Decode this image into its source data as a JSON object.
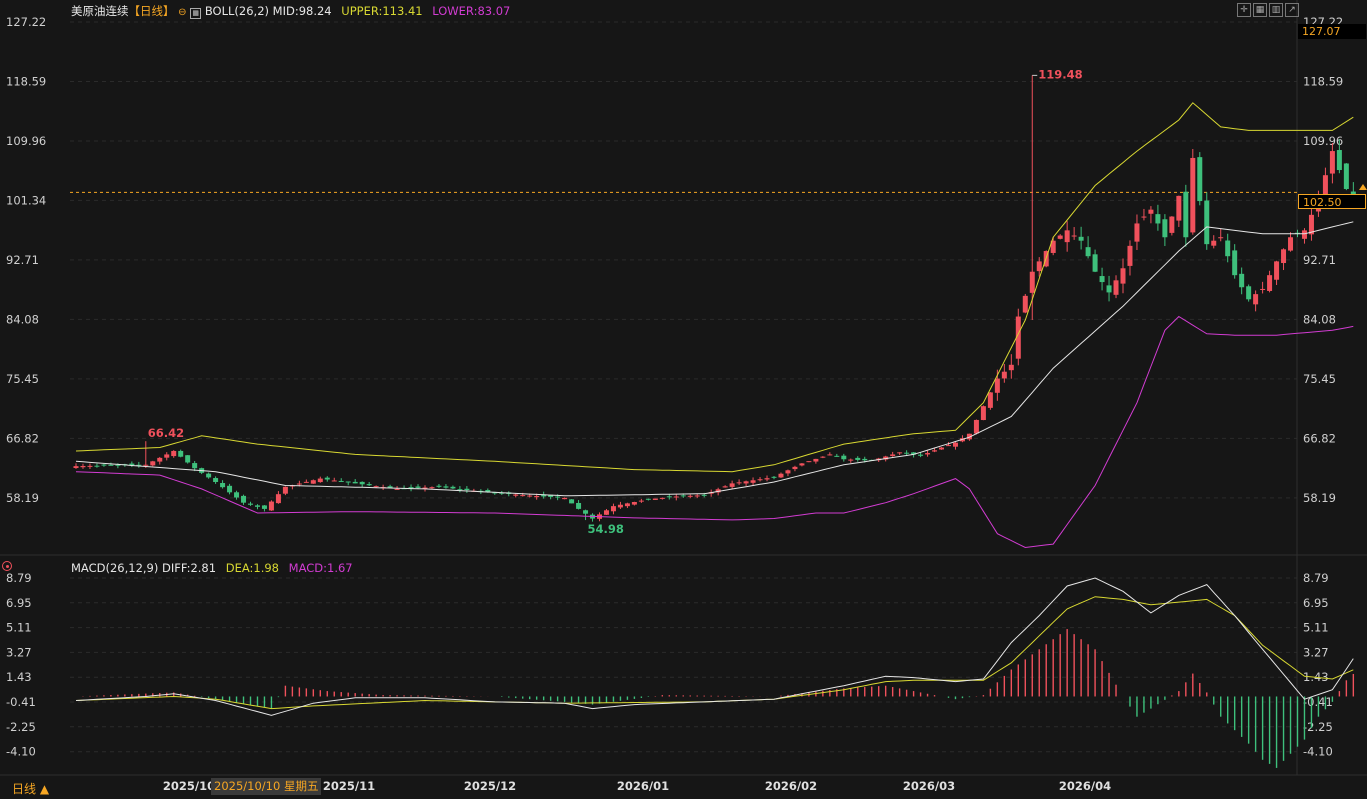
{
  "header": {
    "symbol": "美原油连续",
    "period": "【日线】",
    "boll_label": "BOLL(26,2)",
    "mid": "MID:98.24",
    "upper": "UPPER:113.41",
    "lower": "LOWER:83.07"
  },
  "macd_header": {
    "label": "MACD(26,12,9)",
    "diff": "DIFF:2.81",
    "dea": "DEA:1.98",
    "macd": "MACD:1.67"
  },
  "toolbar": {
    "icons": [
      "crosshair-icon",
      "grid-icon",
      "bars-icon",
      "share-icon"
    ]
  },
  "current_price_tag": "102.50",
  "top_price_tag": "127.07",
  "bottom_bar": {
    "period_label": "日线 ▲",
    "cursor_date": "2025/10/10 星期五"
  },
  "colors": {
    "up": "#f0515c",
    "down": "#3ec07c",
    "mid": "#e6e6e6",
    "upper": "#d8d832",
    "lower": "#d23cd2",
    "dea": "#d8d832",
    "diff": "#e6e6e6",
    "bg": "#161616",
    "price_line": "#f5a623"
  },
  "chart_data": [
    {
      "type": "candlestick",
      "title": "美原油连续",
      "y_ticks": [
        "127.22",
        "118.59",
        "109.96",
        "101.34",
        "92.71",
        "84.08",
        "75.45",
        "66.82",
        "58.19"
      ],
      "ylim": [
        50.5,
        127.22
      ],
      "x_labels": [
        "2025/10",
        "2025/11",
        "2025/12",
        "2026/01",
        "2026/02",
        "2026/03",
        "2026/04"
      ],
      "annotations": [
        {
          "text": "66.42",
          "type": "high"
        },
        {
          "text": "54.98",
          "type": "low"
        },
        {
          "text": "119.48",
          "type": "high"
        }
      ],
      "current_price": 102.5,
      "keypoints": [
        [
          0,
          62.8
        ],
        [
          10,
          63.0
        ],
        [
          14,
          65.0
        ],
        [
          17,
          62.5
        ],
        [
          20,
          60.5
        ],
        [
          24,
          57.5
        ],
        [
          27,
          56.6
        ],
        [
          30,
          59.8
        ],
        [
          35,
          61.0
        ],
        [
          40,
          60.3
        ],
        [
          46,
          59.5
        ],
        [
          52,
          59.8
        ],
        [
          58,
          59.1
        ],
        [
          64,
          58.6
        ],
        [
          70,
          58.2
        ],
        [
          72,
          56.6
        ],
        [
          74,
          55.2
        ],
        [
          77,
          57.0
        ],
        [
          82,
          58.0
        ],
        [
          86,
          58.4
        ],
        [
          90,
          58.6
        ],
        [
          94,
          60.3
        ],
        [
          100,
          61.2
        ],
        [
          104,
          63.2
        ],
        [
          108,
          64.5
        ],
        [
          110,
          63.8
        ],
        [
          114,
          63.6
        ],
        [
          118,
          64.8
        ],
        [
          121,
          64.3
        ],
        [
          124,
          65.5
        ],
        [
          126,
          66.2
        ],
        [
          128,
          67.5
        ],
        [
          130,
          71.5
        ],
        [
          132,
          75.5
        ],
        [
          134,
          77.5
        ],
        [
          135,
          84.5
        ],
        [
          136,
          87.5
        ],
        [
          137,
          91.0
        ],
        [
          140,
          95.5
        ],
        [
          142,
          97.0
        ],
        [
          144,
          95.5
        ],
        [
          146,
          91.0
        ],
        [
          148,
          88.0
        ],
        [
          150,
          91.5
        ],
        [
          152,
          98.0
        ],
        [
          154,
          100.0
        ],
        [
          156,
          96.0
        ],
        [
          158,
          102.0
        ],
        [
          159,
          96.0
        ],
        [
          160,
          107.5
        ],
        [
          162,
          95.0
        ],
        [
          164,
          96.0
        ],
        [
          166,
          90.5
        ],
        [
          168,
          87.0
        ],
        [
          170,
          88.5
        ],
        [
          172,
          92.5
        ],
        [
          174,
          96.0
        ],
        [
          176,
          97.0
        ],
        [
          178,
          101.5
        ],
        [
          180,
          108.5
        ],
        [
          182,
          103.0
        ],
        [
          183,
          102.0
        ]
      ],
      "boll_mid_keypoints": [
        [
          0,
          63.5
        ],
        [
          20,
          62.0
        ],
        [
          30,
          60.0
        ],
        [
          50,
          59.5
        ],
        [
          70,
          58.5
        ],
        [
          90,
          58.8
        ],
        [
          100,
          60.5
        ],
        [
          110,
          63.0
        ],
        [
          120,
          64.5
        ],
        [
          128,
          67.0
        ],
        [
          134,
          70.0
        ],
        [
          140,
          77.0
        ],
        [
          150,
          86.0
        ],
        [
          158,
          94.0
        ],
        [
          162,
          97.5
        ],
        [
          166,
          97.0
        ],
        [
          170,
          96.5
        ],
        [
          176,
          96.5
        ],
        [
          180,
          97.5
        ],
        [
          183,
          98.24
        ]
      ],
      "boll_upper_keypoints": [
        [
          0,
          65.0
        ],
        [
          12,
          65.5
        ],
        [
          18,
          67.2
        ],
        [
          26,
          66.0
        ],
        [
          40,
          64.5
        ],
        [
          60,
          63.5
        ],
        [
          80,
          62.3
        ],
        [
          94,
          62.0
        ],
        [
          100,
          63.0
        ],
        [
          110,
          66.0
        ],
        [
          120,
          67.5
        ],
        [
          126,
          68.0
        ],
        [
          130,
          72.0
        ],
        [
          136,
          84.0
        ],
        [
          140,
          96.0
        ],
        [
          146,
          103.5
        ],
        [
          152,
          108.5
        ],
        [
          158,
          113.0
        ],
        [
          160,
          115.5
        ],
        [
          164,
          112.0
        ],
        [
          168,
          111.5
        ],
        [
          174,
          111.5
        ],
        [
          180,
          111.5
        ],
        [
          183,
          113.41
        ]
      ],
      "boll_lower_keypoints": [
        [
          0,
          62.0
        ],
        [
          12,
          61.5
        ],
        [
          18,
          59.5
        ],
        [
          26,
          56.0
        ],
        [
          40,
          56.2
        ],
        [
          60,
          56.0
        ],
        [
          80,
          55.3
        ],
        [
          94,
          55.0
        ],
        [
          100,
          55.2
        ],
        [
          106,
          56.0
        ],
        [
          110,
          56.0
        ],
        [
          116,
          57.5
        ],
        [
          120,
          58.8
        ],
        [
          126,
          61.0
        ],
        [
          128,
          59.5
        ],
        [
          132,
          53.0
        ],
        [
          136,
          51.0
        ],
        [
          140,
          51.5
        ],
        [
          146,
          60.0
        ],
        [
          152,
          72.0
        ],
        [
          156,
          82.5
        ],
        [
          158,
          84.5
        ],
        [
          162,
          82.0
        ],
        [
          166,
          81.8
        ],
        [
          172,
          81.8
        ],
        [
          180,
          82.5
        ],
        [
          183,
          83.07
        ]
      ]
    },
    {
      "type": "macd",
      "y_ticks": [
        "8.79",
        "6.95",
        "5.11",
        "3.27",
        "1.43",
        "-0.41",
        "-2.25",
        "-4.10"
      ],
      "ylim": [
        -5.6,
        9.2
      ],
      "series_names": [
        "DIFF",
        "DEA",
        "MACD"
      ],
      "diff_keypoints": [
        [
          0,
          -0.3
        ],
        [
          10,
          0.0
        ],
        [
          14,
          0.2
        ],
        [
          20,
          -0.3
        ],
        [
          28,
          -1.4
        ],
        [
          34,
          -0.5
        ],
        [
          40,
          -0.1
        ],
        [
          50,
          -0.1
        ],
        [
          60,
          -0.4
        ],
        [
          70,
          -0.5
        ],
        [
          74,
          -0.9
        ],
        [
          80,
          -0.6
        ],
        [
          90,
          -0.4
        ],
        [
          100,
          -0.2
        ],
        [
          110,
          0.8
        ],
        [
          116,
          1.5
        ],
        [
          120,
          1.4
        ],
        [
          126,
          1.1
        ],
        [
          130,
          1.3
        ],
        [
          134,
          4.0
        ],
        [
          138,
          6.0
        ],
        [
          142,
          8.2
        ],
        [
          146,
          8.79
        ],
        [
          150,
          7.8
        ],
        [
          154,
          6.2
        ],
        [
          158,
          7.5
        ],
        [
          162,
          8.3
        ],
        [
          166,
          6.0
        ],
        [
          170,
          3.5
        ],
        [
          176,
          -0.2
        ],
        [
          180,
          0.5
        ],
        [
          183,
          2.81
        ]
      ],
      "dea_keypoints": [
        [
          0,
          -0.3
        ],
        [
          14,
          0.0
        ],
        [
          20,
          -0.2
        ],
        [
          28,
          -0.9
        ],
        [
          34,
          -0.7
        ],
        [
          50,
          -0.3
        ],
        [
          70,
          -0.5
        ],
        [
          90,
          -0.4
        ],
        [
          100,
          -0.2
        ],
        [
          110,
          0.5
        ],
        [
          116,
          1.1
        ],
        [
          120,
          1.2
        ],
        [
          130,
          1.2
        ],
        [
          134,
          2.5
        ],
        [
          138,
          4.5
        ],
        [
          142,
          6.5
        ],
        [
          146,
          7.4
        ],
        [
          150,
          7.2
        ],
        [
          154,
          6.8
        ],
        [
          158,
          7.0
        ],
        [
          162,
          7.2
        ],
        [
          166,
          6.0
        ],
        [
          170,
          3.8
        ],
        [
          176,
          1.5
        ],
        [
          180,
          1.3
        ],
        [
          183,
          1.98
        ]
      ],
      "macd_keypoints": [
        [
          0,
          0.0
        ],
        [
          14,
          0.3
        ],
        [
          20,
          -0.2
        ],
        [
          28,
          -0.9
        ],
        [
          30,
          0.8
        ],
        [
          36,
          0.4
        ],
        [
          44,
          0.1
        ],
        [
          60,
          0.0
        ],
        [
          70,
          -0.4
        ],
        [
          74,
          -0.6
        ],
        [
          84,
          0.1
        ],
        [
          100,
          0.0
        ],
        [
          110,
          0.6
        ],
        [
          116,
          0.8
        ],
        [
          120,
          0.4
        ],
        [
          126,
          -0.2
        ],
        [
          130,
          0.1
        ],
        [
          134,
          2.0
        ],
        [
          138,
          3.5
        ],
        [
          142,
          5.0
        ],
        [
          146,
          3.5
        ],
        [
          150,
          0.0
        ],
        [
          152,
          -1.5
        ],
        [
          154,
          -0.9
        ],
        [
          158,
          0.4
        ],
        [
          160,
          1.7
        ],
        [
          162,
          0.3
        ],
        [
          164,
          -1.5
        ],
        [
          168,
          -3.5
        ],
        [
          170,
          -4.7
        ],
        [
          172,
          -5.3
        ],
        [
          176,
          -3.2
        ],
        [
          178,
          -1.5
        ],
        [
          180,
          -0.4
        ],
        [
          182,
          1.2
        ],
        [
          183,
          1.67
        ]
      ]
    }
  ]
}
